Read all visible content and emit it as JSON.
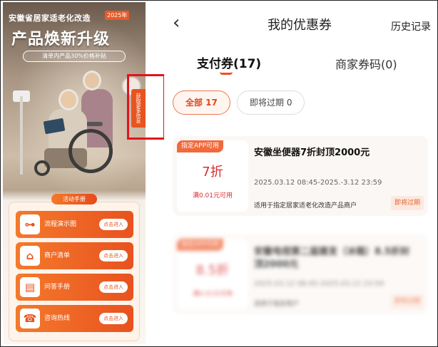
{
  "promo": {
    "top_title": "安徽省居家适老化改造",
    "year_badge": "2025年",
    "headline": "产品焕新升级",
    "subline": "清单内产品30%价格补贴",
    "side_tab": "获取更多信息",
    "handbook_tag": "活动手册",
    "menu": [
      {
        "label": "流程演示图",
        "button": "点击进入",
        "icon": "flow-icon"
      },
      {
        "label": "商户清单",
        "button": "点击进入",
        "icon": "shop-icon"
      },
      {
        "label": "问答手册",
        "button": "点击进入",
        "icon": "book-icon"
      },
      {
        "label": "咨询热线",
        "button": "点击进入",
        "icon": "phone-icon"
      }
    ]
  },
  "screen": {
    "title": "我的优惠券",
    "history": "历史记录",
    "tabs": {
      "pay": "支付券(17)",
      "merchant": "商家券码(0)"
    },
    "filters": {
      "all": "全部 17",
      "expiring": "即将过期 0"
    },
    "coupons": [
      {
        "tag": "指定APP可用",
        "discount": "7折",
        "condition": "满0.01元可用",
        "title": "安徽坐便器7折封顶2000元",
        "date": "2025.03.12 08:45-2025.-3.12 23:59",
        "scope": "适用于指定居家适老化改造产品商户",
        "status": "即将过期"
      },
      {
        "tag": "指定APP可用",
        "discount": "8.5折",
        "condition": "满0.01元可用",
        "title": "安徽电视第二届建发（冰箱）8.5折封顶2000元",
        "date": "2025.03.12 08:45-2025.03.12 23:59",
        "scope": "适用于指定商户",
        "status": "即将过期"
      }
    ]
  },
  "colors": {
    "accent": "#e8541f",
    "discount_red": "#d92c2c",
    "annotation_red": "#e0141b"
  }
}
